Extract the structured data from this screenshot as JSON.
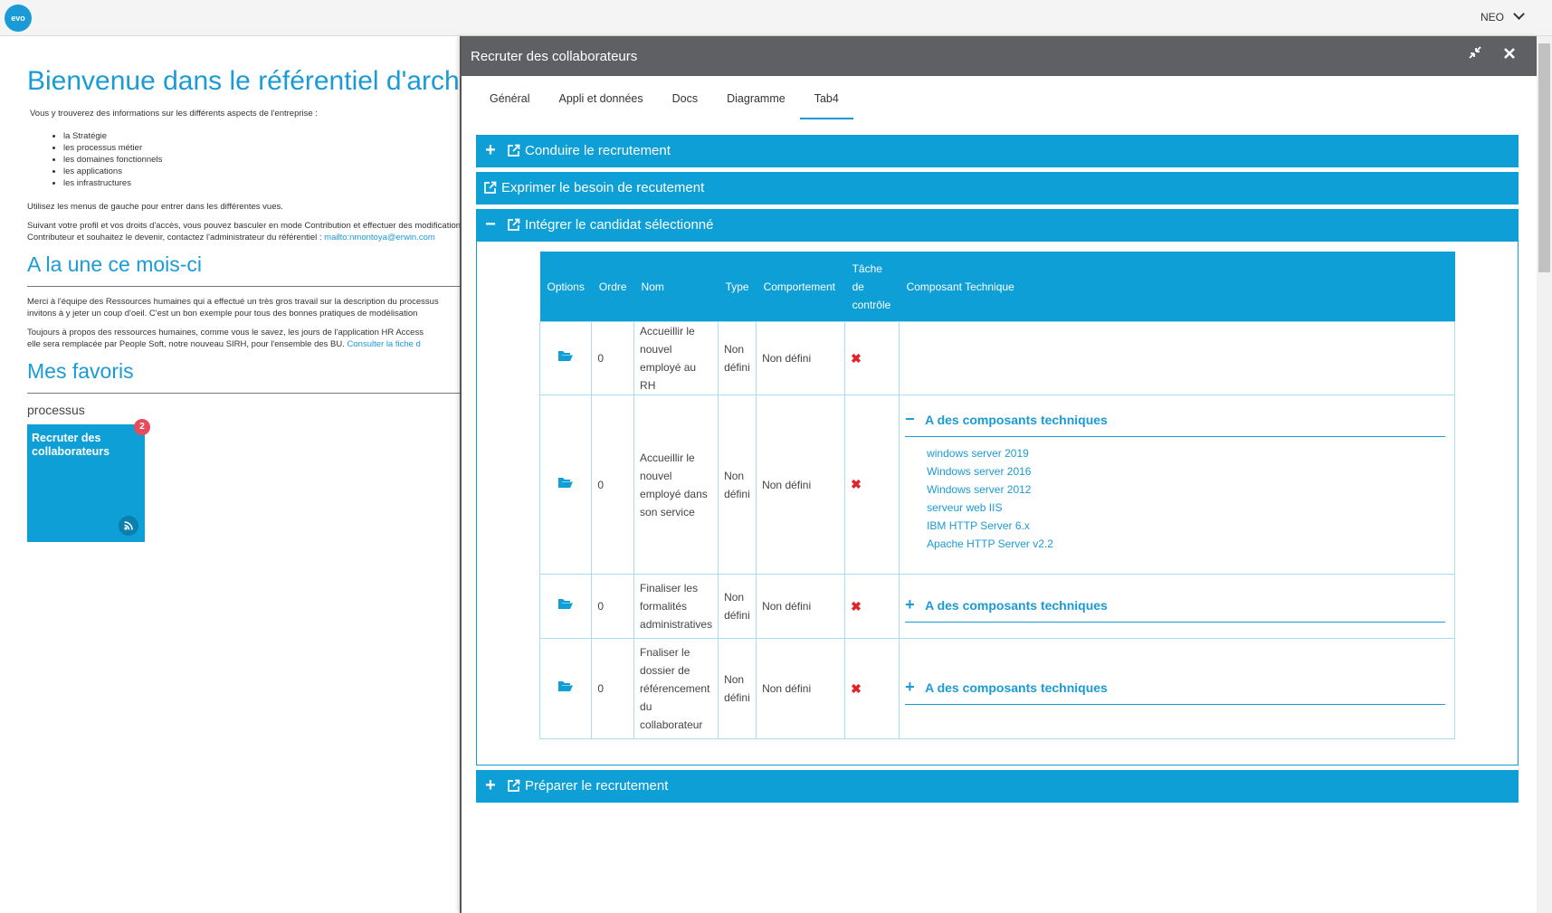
{
  "topbar": {
    "logo": "evo",
    "user": "NEO"
  },
  "background_page": {
    "title": "Bienvenue dans le référentiel d'architecture d'entreprise.",
    "intro": "Vous y trouverez des informations sur les différents aspects de l'entreprise :",
    "aspects": [
      "la Stratégie",
      "les processus métier",
      "les domaines fonctionnels",
      "les applications",
      "les infrastructures"
    ],
    "menus_note": "Utilisez les menus de gauche pour entrer dans les différentes vues.",
    "profile_note_1": "Suivant votre profil et vos droits d'accès, vous pouvez basculer en mode Contribution et effectuer des modifications",
    "profile_note_2": "Contributeur et souhaitez le devenir, contactez l'administrateur du référentiel :",
    "admin_link": "mailto:nmontoya@erwin.com",
    "news_heading": "A la une ce mois-ci",
    "news_1a": "Merci à l'équipe des Ressources humaines qui a effectué un très gros travail sur la description du processus",
    "news_1b": "invitons à y jeter un coup d'oeil. C'est un bon exemple pour tous des bonnes pratiques de modélisation",
    "news_2a": "Toujours à propos des ressources humaines, comme vous le savez, les jours de l'application HR Access",
    "news_2b": "elle sera remplacée par People Soft, notre nouveau SIRH, pour l'ensemble des BU.",
    "news_2_link": "Consulter la fiche d",
    "favorites_heading": "Mes favoris",
    "favorites_category": "processus",
    "favorite_tile": {
      "title": "Recruter des collaborateurs",
      "badge": "2"
    }
  },
  "panel": {
    "title": "Recruter des collaborateurs",
    "tabs": [
      "Général",
      "Appli et données",
      "Docs",
      "Diagramme",
      "Tab4"
    ],
    "active_tab": "Tab4",
    "sections": [
      {
        "sign": "+",
        "title": "Conduire le recrutement"
      },
      {
        "sign": "",
        "title": "Exprimer le besoin de recutement"
      },
      {
        "sign": "−",
        "title": "Intégrer le candidat sélectionné"
      },
      {
        "sign": "+",
        "title": "Préparer le recrutement"
      }
    ],
    "table": {
      "headers": [
        "Options",
        "Ordre",
        "Nom",
        "Type",
        "Comportement",
        "Tâche de contrôle",
        "Composant Technique"
      ],
      "rows": [
        {
          "ordre": "0",
          "nom": "Accueillir le nouvel employé au RH",
          "type": "Non défini",
          "comportement": "Non défini"
        },
        {
          "ordre": "0",
          "nom": "Accueillir le nouvel employé dans son service",
          "type": "Non défini",
          "comportement": "Non défini",
          "components_label": "A des composants techniques",
          "components": [
            "windows server 2019",
            "Windows server 2016",
            "Windows server 2012",
            "serveur web IIS",
            "IBM HTTP Server 6.x",
            "Apache HTTP Server v2.2"
          ]
        },
        {
          "ordre": "0",
          "nom": "Finaliser les formalités administratives",
          "type": "Non défini",
          "comportement": "Non défini",
          "components_label": "A des composants techniques"
        },
        {
          "ordre": "0",
          "nom": "Fnaliser le dossier de référencement du collaborateur",
          "type": "Non défini",
          "comportement": "Non défini",
          "components_label": "A des composants techniques"
        }
      ]
    }
  },
  "colors": {
    "accent": "#0d9fd6",
    "header": "#5f6064",
    "error": "#e3222c",
    "badge": "#e74c5c"
  },
  "icons": {
    "folder": "folder-open-icon",
    "cross": "cross-icon",
    "external": "external-link-icon",
    "rss": "rss-icon"
  }
}
